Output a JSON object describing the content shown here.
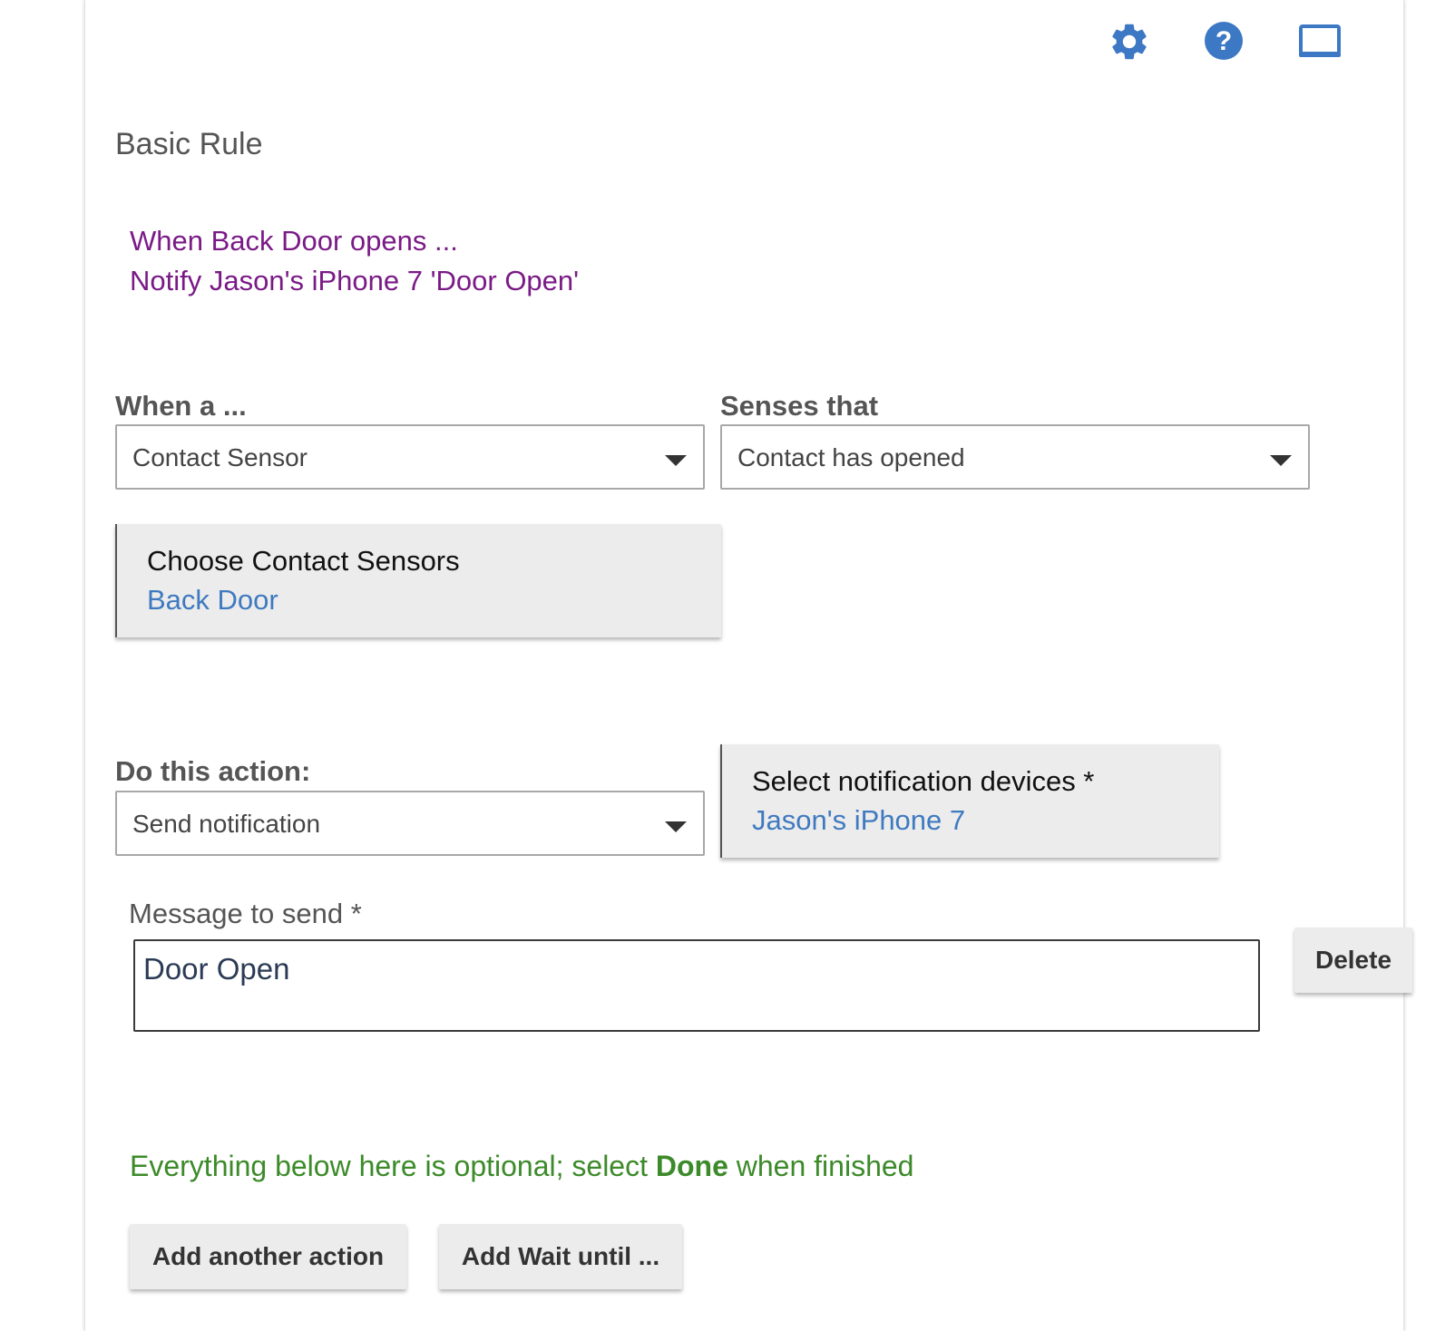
{
  "toolbar": {
    "icons": [
      "gear-icon",
      "help-icon",
      "window-icon"
    ],
    "accent_color": "#3d78c4"
  },
  "page": {
    "title": "Basic Rule"
  },
  "summary": {
    "line1": "When Back Door opens ...",
    "line2": "Notify Jason's iPhone 7 'Door Open'",
    "color": "#7a1a86"
  },
  "trigger": {
    "device_label": "When a ...",
    "device_value": "Contact Sensor",
    "senses_label": "Senses that",
    "senses_value": "Contact has opened"
  },
  "device_picker": {
    "title": "Choose Contact Sensors",
    "selected": "Back Door"
  },
  "action": {
    "label": "Do this action:",
    "value": "Send notification"
  },
  "notification_picker": {
    "title": "Select notification devices *",
    "selected": "Jason's iPhone 7"
  },
  "message": {
    "label": "Message to send *",
    "value": "Door Open"
  },
  "delete_label": "Delete",
  "optional_note": {
    "prefix": "Everything below here is optional; select ",
    "bold": "Done",
    "suffix": " when finished",
    "color": "#3c8a2a"
  },
  "buttons": {
    "add_action": "Add another action",
    "add_wait": "Add Wait until ..."
  }
}
